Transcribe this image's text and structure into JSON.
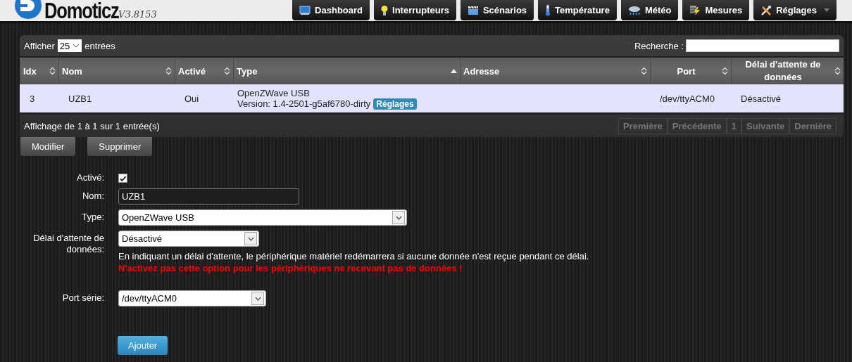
{
  "header": {
    "logo": "Domoticz",
    "version": "V3.8153",
    "nav": [
      {
        "label": "Dashboard",
        "kind": "dashboard",
        "dropdown": false
      },
      {
        "label": "Interrupteurs",
        "kind": "bulb",
        "dropdown": false
      },
      {
        "label": "Scénarios",
        "kind": "clapper",
        "dropdown": false
      },
      {
        "label": "Température",
        "kind": "thermometer",
        "dropdown": false
      },
      {
        "label": "Météo",
        "kind": "weather",
        "dropdown": false
      },
      {
        "label": "Mesures",
        "kind": "meter",
        "dropdown": false
      },
      {
        "label": "Réglages",
        "kind": "tools",
        "dropdown": true
      }
    ]
  },
  "table": {
    "length_prefix": "Afficher",
    "length_value": "25",
    "length_suffix": "entrées",
    "search_label": "Recherche :",
    "columns": [
      {
        "label": "Idx",
        "sorted_ascending": false
      },
      {
        "label": "Nom",
        "sorted_ascending": false
      },
      {
        "label": "Activé",
        "sorted_ascending": false
      },
      {
        "label": "Type",
        "sorted_ascending": true
      },
      {
        "label": "Adresse",
        "sorted_ascending": false
      },
      {
        "label": "Port",
        "sorted_ascending": false
      },
      {
        "label": "Délai d'attente de données",
        "sorted_ascending": false
      }
    ],
    "rows": [
      {
        "selected": true,
        "idx": "3",
        "name": "UZB1",
        "active": "Oui",
        "type": "OpenZWave USB",
        "version": "Version: 1.4-2501-g5af6780-dirty",
        "type_button": "Réglages",
        "port": "/dev/ttyACM0",
        "timeout": "Désactivé"
      }
    ],
    "info": "Affichage de 1 à 1 sur 1 entrée(s)",
    "pagination": [
      {
        "label": "Première",
        "disabled": true
      },
      {
        "label": "Précédente",
        "disabled": true
      },
      {
        "label": "1",
        "disabled": true
      },
      {
        "label": "Suivante",
        "disabled": true
      },
      {
        "label": "Dernière",
        "disabled": true
      }
    ]
  },
  "actions": [
    "Modifier",
    "Supprimer"
  ],
  "form": {
    "fields": [
      {
        "kind": "checkbox",
        "label": "Activé:",
        "checked": true
      },
      {
        "kind": "text",
        "label": "Nom:",
        "value": "UZB1"
      },
      {
        "kind": "select",
        "label": "Type:",
        "value": "OpenZWave USB"
      },
      {
        "kind": "select",
        "label": "Délai d'attente de données:",
        "value": "Désactivé",
        "help": "En indiquant un délai d'attente, le périphérique matériel redémarrera si aucune donnée n'est reçue pendant ce délai.",
        "warning": "N'activez pas cette option pour les périphériques ne recevant pas de données !"
      },
      {
        "kind": "select",
        "label": "Port série:",
        "value": "/dev/ttyACM0"
      }
    ],
    "submit": "Ajouter"
  }
}
